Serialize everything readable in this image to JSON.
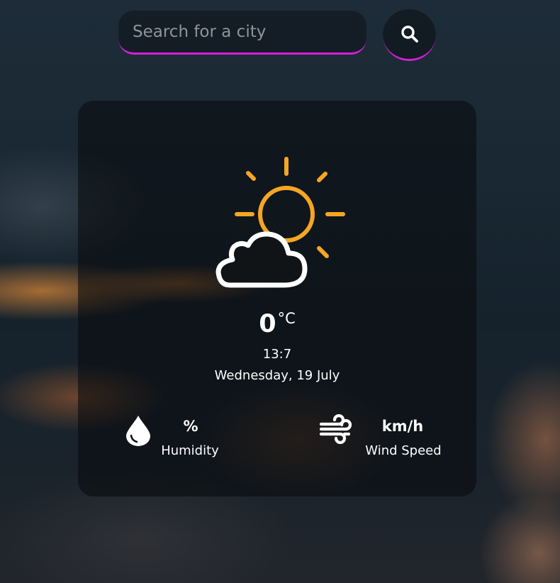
{
  "search": {
    "placeholder": "Search for a city",
    "value": "",
    "button_icon": "search-icon"
  },
  "colors": {
    "accent": "#d31fd9",
    "sun": "#f5a623",
    "text": "#ffffff"
  },
  "weather": {
    "icon": "partly-cloudy-icon",
    "temperature": "0",
    "unit": "°C",
    "time": "13:7",
    "date": "Wednesday, 19 July"
  },
  "stats": {
    "humidity": {
      "icon": "water-drop-icon",
      "value": "%",
      "label": "Humidity"
    },
    "wind": {
      "icon": "wind-icon",
      "value": "km/h",
      "label": "Wind Speed"
    }
  }
}
